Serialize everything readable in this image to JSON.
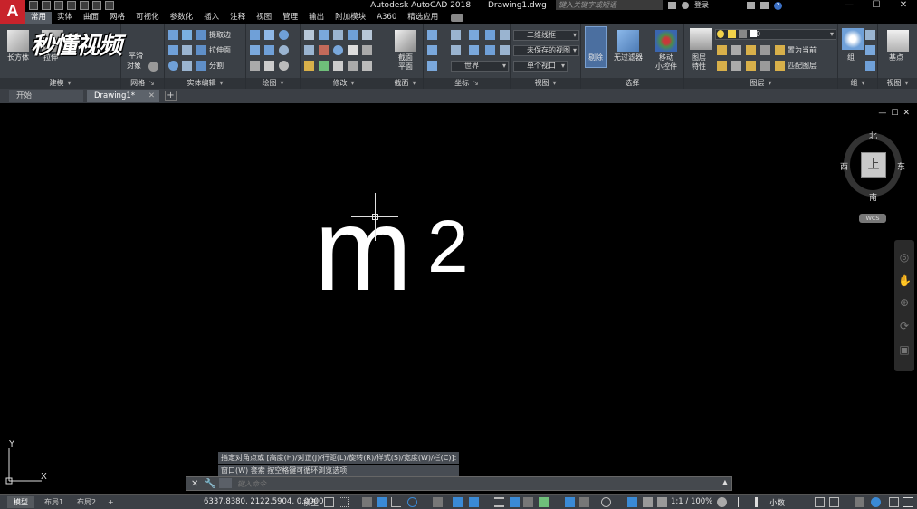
{
  "app": {
    "title": "Autodesk AutoCAD 2018",
    "file": "Drawing1.dwg",
    "logo_letter": "A",
    "watermark": "秒懂视频"
  },
  "search": {
    "placeholder": "键入关键字或短语"
  },
  "account": {
    "login": "登录"
  },
  "window_buttons": {
    "minimize": "—",
    "restore": "☐",
    "close": "✕"
  },
  "menu_tabs": [
    "常用",
    "实体",
    "曲面",
    "网格",
    "可视化",
    "参数化",
    "插入",
    "注释",
    "视图",
    "管理",
    "输出",
    "附加模块",
    "A360",
    "精选应用"
  ],
  "ribbon": {
    "panels": [
      "建模",
      "网格",
      "实体编辑",
      "绘图",
      "修改",
      "截面",
      "坐标",
      "视图",
      "选择",
      "图层",
      "组",
      "视图"
    ],
    "labels": {
      "box": "长方体",
      "extrude": "拉伸",
      "smooth1": "平滑",
      "smooth2": "对象",
      "extract_edges": "提取边",
      "extrude_face": "拉伸面",
      "separate": "分割",
      "section_plane1": "截面",
      "section_plane2": "平面",
      "cull": "剔除",
      "no_filter": "无过滤器",
      "move_gizmo1": "移动",
      "move_gizmo2": "小控件",
      "layer_props1": "图层",
      "layer_props2": "特性",
      "set_current": "置为当前",
      "match_layer": "匹配图层",
      "group": "组",
      "base_point": "基点"
    },
    "visual_style": "二维线框",
    "unsaved_view": "未保存的视图",
    "ucs_world": "世界",
    "single_viewport": "单个视口",
    "layer_name": "0"
  },
  "file_tabs": [
    {
      "label": "开始"
    },
    {
      "label": "Drawing1*"
    }
  ],
  "file_tab_close": "✕",
  "file_tab_add": "+",
  "drawing": {
    "base": "m",
    "superscript": "2"
  },
  "viewport_controls": [
    "—",
    "☐",
    "✕"
  ],
  "viewcube": {
    "north": "北",
    "south": "南",
    "east": "东",
    "west": "西",
    "face": "上",
    "wcs": "WCS"
  },
  "ucs": {
    "x": "X",
    "y": "Y"
  },
  "command": {
    "history": [
      "指定对角点或 [高度(H)/对正(J)/行距(L)/旋转(R)/样式(S)/宽度(W)/栏(C)]:",
      "窗口(W)  套索   按空格键可循环浏览选项"
    ],
    "placeholder": "键入命令"
  },
  "status": {
    "layout_tabs": [
      "模型",
      "布局1",
      "布局2"
    ],
    "layout_add": "+",
    "coordinates": "6337.8380, 2122.5904, 0.0000",
    "space": "模型",
    "annotation_scale": "1:1 / 100%",
    "units": "小数"
  },
  "colors": {
    "accent": "#c8232b",
    "ribbon_bg": "#3b4046",
    "canvas_bg": "#000000",
    "active_tab": "#555b63"
  }
}
